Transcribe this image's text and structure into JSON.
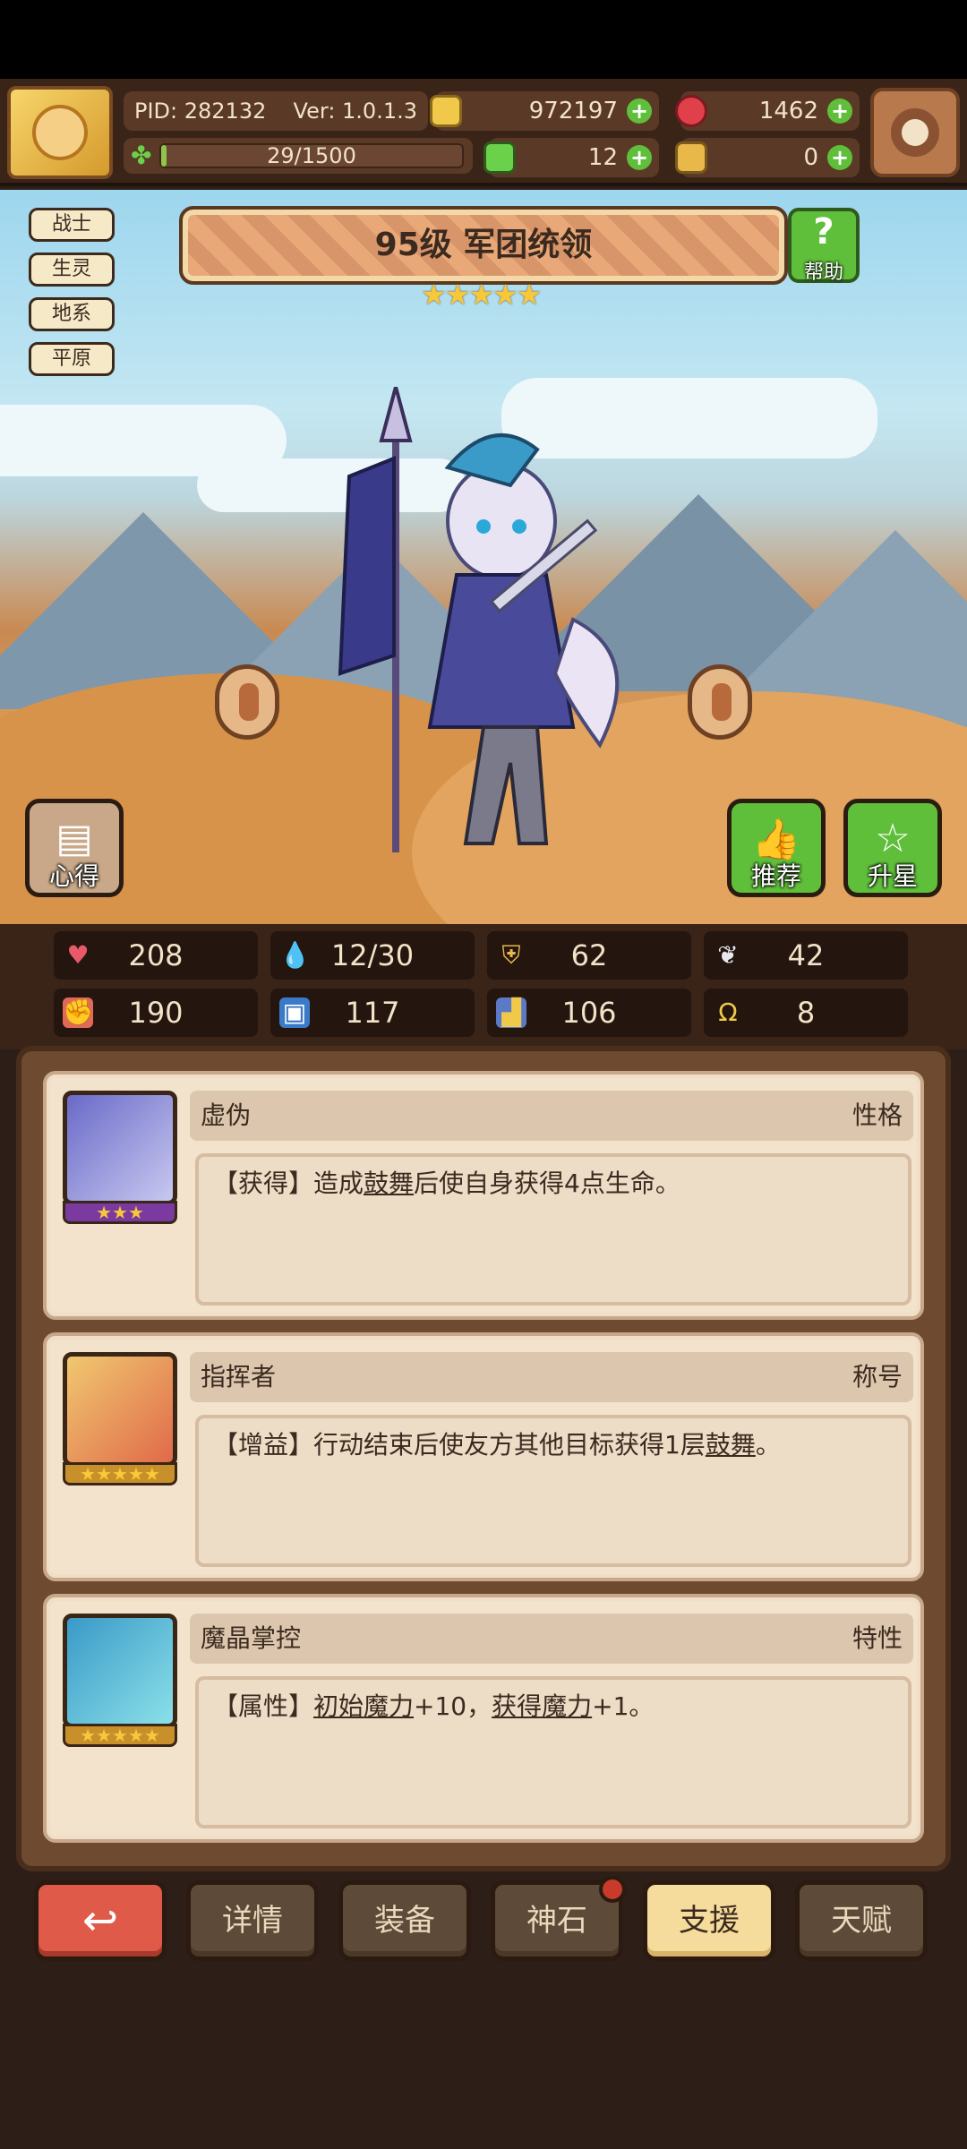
{
  "header": {
    "pid": "PID: 282132",
    "version": "Ver: 1.0.1.3",
    "exp_text": "29/1500",
    "exp_progress": 0.019,
    "gold": "972197",
    "ruby": "1462",
    "clover": "12",
    "ticket": "0"
  },
  "hero": {
    "tags": [
      "战士",
      "生灵",
      "地系",
      "平原"
    ],
    "title": "95级 军团统领",
    "stars": "★★★★★",
    "help_label": "帮助",
    "insight_label": "心得",
    "recommend_label": "推荐",
    "upgrade_label": "升星"
  },
  "stats": {
    "hp": "208",
    "mana": "12/30",
    "defense": "62",
    "speed": "42",
    "attack": "190",
    "magic": "117",
    "agility": "106",
    "luck": "8"
  },
  "cards": [
    {
      "name": "虚伪",
      "kind": "性格",
      "stars": "★★★",
      "desc_prefix": "【获得】造成",
      "desc_link": "鼓舞",
      "desc_suffix": "后使自身获得4点生命。"
    },
    {
      "name": "指挥者",
      "kind": "称号",
      "stars": "★★★★★",
      "desc_prefix": "【增益】行动结束后使友方其他目标获得1层",
      "desc_link": "鼓舞",
      "desc_suffix": "。"
    },
    {
      "name": "魔晶掌控",
      "kind": "特性",
      "stars": "★★★★★",
      "desc_prefix": "【属性】",
      "desc_link": "初始魔力",
      "desc_mid": "+10，",
      "desc_link2": "获得魔力",
      "desc_suffix": "+1。"
    }
  ],
  "nav": {
    "back_icon": "↩",
    "details": "详情",
    "equipment": "装备",
    "godstone": "神石",
    "support": "支援",
    "talent": "天赋"
  },
  "colors": {
    "active_tab": "#f6dc9c",
    "back_button": "#e05a4a",
    "green_button": "#5fbf3a"
  }
}
